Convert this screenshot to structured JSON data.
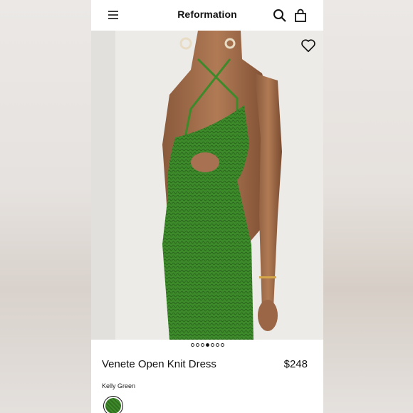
{
  "navbar": {
    "menu_icon": "hamburger-menu-icon",
    "brand": "Reformation",
    "search_icon": "search-icon",
    "bag_icon": "shopping-bag-icon"
  },
  "hero": {
    "favorite_icon": "heart-outline-icon",
    "image_description": "model-wearing-green-knit-dress",
    "carousel": {
      "total": 7,
      "active_index": 3
    }
  },
  "product": {
    "name": "Venete Open Knit Dress",
    "price": "$248",
    "color_name": "Kelly Green",
    "swatch_color": "#3e8a2a"
  }
}
